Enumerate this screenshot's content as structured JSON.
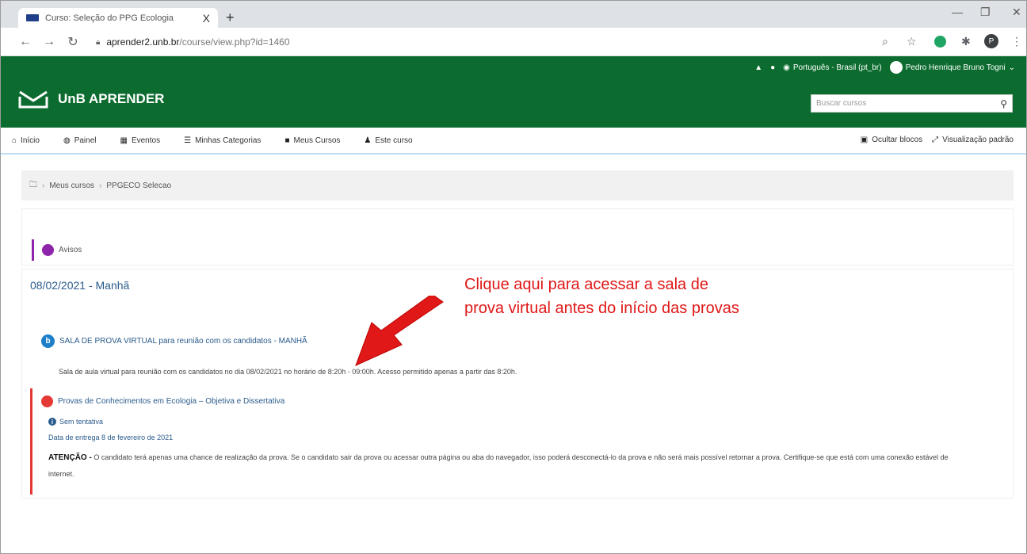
{
  "browser": {
    "tab_title": "Curso: Seleção do PPG Ecologia",
    "tab_close": "X",
    "new_tab": "+",
    "url_host": "aprender2.unb.br",
    "url_path": "/course/view.php?id=1460",
    "profile_initial": "P"
  },
  "header": {
    "language": "Português - Brasil (pt_br)",
    "user_name": "Pedro Henrique Bruno Togni",
    "brand": "UnB APRENDER",
    "search_placeholder": "Buscar cursos"
  },
  "menu": {
    "items": [
      {
        "icon": "home-icon",
        "label": "Início"
      },
      {
        "icon": "dashboard-icon",
        "label": "Painel"
      },
      {
        "icon": "calendar-icon",
        "label": "Eventos"
      },
      {
        "icon": "list-icon",
        "label": "Minhas Categorias"
      },
      {
        "icon": "briefcase-icon",
        "label": "Meus Cursos"
      },
      {
        "icon": "users-icon",
        "label": "Este curso"
      }
    ],
    "hide_blocks": "Ocultar blocos",
    "default_view": "Visualização padrão"
  },
  "breadcrumb": {
    "items": [
      "Meus cursos",
      "PPGECO Selecao"
    ]
  },
  "course": {
    "forum_label": "Avisos",
    "section_title": "08/02/2021 - Manhã",
    "bbb_activity": "SALA DE PROVA VIRTUAL para reunião com os candidatos - MANHÃ",
    "bbb_description": "Sala de aula virtual para reunião com os candidatos no dia 08/02/2021 no horário de 8:20h - 09:00h. Acesso permitido apenas a partir das 8:20h.",
    "quiz_title": "Provas de Conhecimentos em Ecologia – Objetiva e Dissertativa",
    "quiz_attempt": "Sem tentativa",
    "quiz_due": "Data de entrega 8 de fevereiro de 2021",
    "quiz_warning_bold": "ATENÇÃO -",
    "quiz_warning_text": "O candidato terá apenas uma chance de realização da prova. Se o candidato sair da prova ou acessar outra página ou aba do navegador, isso poderá desconectá-lo da prova e não será mais possível retornar a prova. Certifique-se que está com uma conexão estável de internet."
  },
  "annotation": {
    "text": "Clique aqui para acessar a sala de prova virtual antes do início das provas",
    "color": "#e01818"
  },
  "colors": {
    "brand_green": "#0c6c2f",
    "link_blue": "#2a5b8c",
    "quiz_red": "#e53935",
    "forum_purple": "#8e24aa"
  }
}
